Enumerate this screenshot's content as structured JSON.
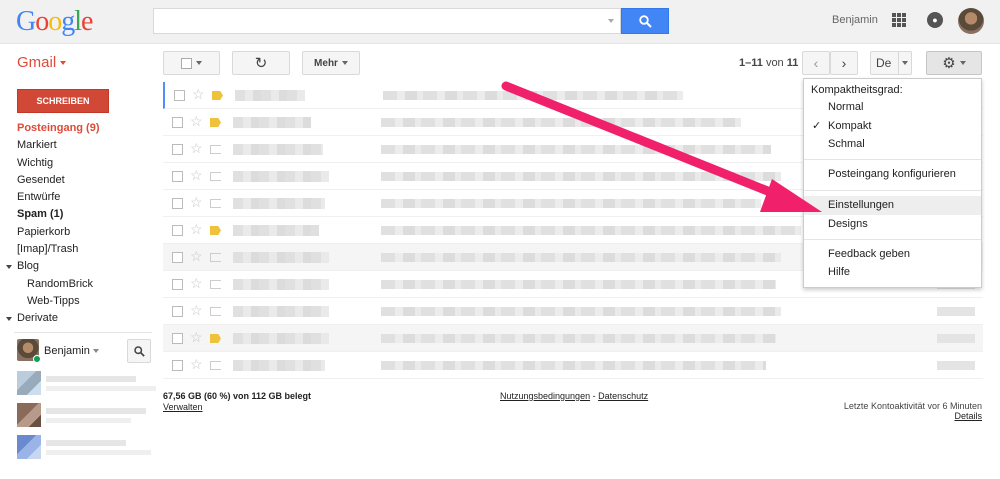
{
  "header": {
    "logo_text": "Google",
    "search": {
      "value": "",
      "placeholder": ""
    },
    "user_name": "Benjamin",
    "icons": [
      "search-icon",
      "apps-grid-icon",
      "notifications-bell-icon",
      "account-avatar"
    ]
  },
  "toolbar": {
    "gmail_label": "Gmail",
    "more_label": "Mehr",
    "pager": {
      "range": "1–11",
      "of_label": "von",
      "total": "11"
    },
    "language_label": "De"
  },
  "sidebar": {
    "compose_label": "SCHREIBEN",
    "items": [
      {
        "label": "Posteingang (9)",
        "state": "active"
      },
      {
        "label": "Markiert",
        "state": "normal"
      },
      {
        "label": "Wichtig",
        "state": "normal"
      },
      {
        "label": "Gesendet",
        "state": "normal"
      },
      {
        "label": "Entwürfe",
        "state": "normal"
      },
      {
        "label": "Spam (1)",
        "state": "bold"
      },
      {
        "label": "Papierkorb",
        "state": "normal"
      },
      {
        "label": "[Imap]/Trash",
        "state": "normal"
      },
      {
        "label": "Blog",
        "state": "group"
      },
      {
        "label": "RandomBrick",
        "state": "sub"
      },
      {
        "label": "Web-Tipps",
        "state": "sub"
      },
      {
        "label": "Derivate",
        "state": "group"
      }
    ],
    "chat_user": "Benjamin"
  },
  "mail_rows": [
    {
      "important": true,
      "read": false
    },
    {
      "important": true,
      "read": false
    },
    {
      "important": false,
      "read": false
    },
    {
      "important": false,
      "read": false
    },
    {
      "important": false,
      "read": false
    },
    {
      "important": true,
      "read": false
    },
    {
      "important": false,
      "read": true
    },
    {
      "important": false,
      "read": false
    },
    {
      "important": false,
      "read": false
    },
    {
      "important": true,
      "read": true
    },
    {
      "important": false,
      "read": false
    }
  ],
  "footer": {
    "storage": "67,56 GB (60 %) von 112 GB belegt",
    "manage": "Verwalten",
    "terms": "Nutzungsbedingungen",
    "dash": "-",
    "privacy": "Datenschutz",
    "last_activity": "Letzte Kontoaktivität vor 6 Minuten",
    "details": "Details"
  },
  "settings_menu": {
    "density_heading": "Kompaktheitsgrad:",
    "density_options": [
      {
        "label": "Normal",
        "checked": false
      },
      {
        "label": "Kompakt",
        "checked": true
      },
      {
        "label": "Schmal",
        "checked": false
      }
    ],
    "configure_inbox": "Posteingang konfigurieren",
    "settings": "Einstellungen",
    "themes": "Designs",
    "feedback": "Feedback geben",
    "help": "Hilfe"
  },
  "colors": {
    "accent_red": "#dd4b39",
    "compose_red": "#d14836",
    "search_blue": "#4285f4",
    "annotation_arrow": "#f0206a",
    "important_marker": "#f0c23b"
  }
}
